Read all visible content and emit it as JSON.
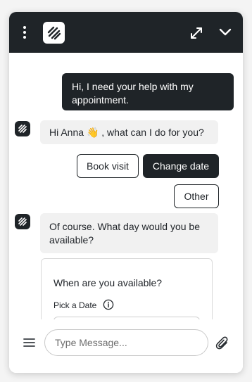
{
  "header": {
    "menu_icon": "more-vertical-icon",
    "logo_icon": "app-logo-icon",
    "expand_icon": "expand-icon",
    "collapse_icon": "chevron-down-icon",
    "background": "#1f2428"
  },
  "messages": [
    {
      "sender": "user",
      "text": "Hi, I need your help with my appointment."
    },
    {
      "sender": "bot",
      "text_before": "Hi Anna ",
      "emoji": "👋",
      "text_after": " , what can I do for you?"
    },
    {
      "sender": "bot",
      "text": "Of course. What day would you be available?"
    }
  ],
  "quick_replies": {
    "book_visit": "Book visit",
    "change_date": "Change date",
    "other": "Other"
  },
  "availability_card": {
    "title": "When are you available?",
    "date_label": "Pick a Date",
    "info_icon": "info-icon"
  },
  "composer": {
    "menu_icon": "hamburger-menu-icon",
    "placeholder": "Type Message...",
    "value": "",
    "attach_icon": "paperclip-icon"
  },
  "colors": {
    "accent_dark": "#1f2428",
    "bot_bubble": "#f1f1f1",
    "page_background": "#f4f4f4"
  }
}
